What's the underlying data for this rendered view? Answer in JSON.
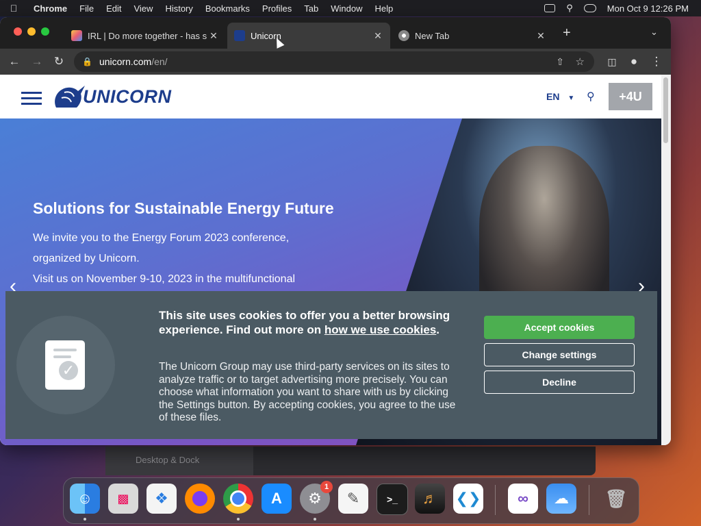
{
  "menubar": {
    "app": "Chrome",
    "items": [
      "File",
      "Edit",
      "View",
      "History",
      "Bookmarks",
      "Profiles",
      "Tab",
      "Window",
      "Help"
    ],
    "clock": "Mon Oct 9  12:26 PM"
  },
  "tabs": [
    {
      "title": "IRL | Do more together - has s"
    },
    {
      "title": "Unicorn"
    },
    {
      "title": "New Tab"
    }
  ],
  "omnibox": {
    "host": "unicorn.com",
    "path": "/en/"
  },
  "site": {
    "logo_text": "UNICORN",
    "lang": "EN",
    "btn_4u": "+4U",
    "hero": {
      "title": "Solutions for Sustainable Energy Future",
      "line1": "We invite you to the Energy Forum 2023 conference,",
      "line2": "organized by Unicorn.",
      "line3": "Visit us on November 9-10, 2023 in the multifunctional"
    },
    "cookie": {
      "title_part1": "This site uses cookies to offer you a better browsing experience. Find out more on ",
      "title_link": "how we use cookies",
      "title_end": ".",
      "body": "The Unicorn Group may use third-party services on its sites to analyze traffic or to target advertising more precisely. You can choose what information you want to share with us by clicking the Settings button. By accepting cookies, you agree to the use of these files.",
      "accept": "Accept cookies",
      "settings": "Change settings",
      "decline": "Decline"
    }
  },
  "background_window": {
    "item": "Desktop & Dock"
  },
  "dock": {
    "icons": [
      "finder-icon",
      "launchpad-icon",
      "safari-icon",
      "firefox-icon",
      "chrome-icon",
      "app-store-icon",
      "system-settings-icon",
      "textedit-icon",
      "terminal-icon",
      "garageband-icon",
      "vscode-icon",
      "visual-studio-icon",
      "weather-icon",
      "trash-icon"
    ],
    "settings_badge": "1"
  },
  "colors": {
    "brand": "#1d3d8c",
    "accept_green": "#4caf50",
    "cookie_bg": "#4b5a63"
  }
}
